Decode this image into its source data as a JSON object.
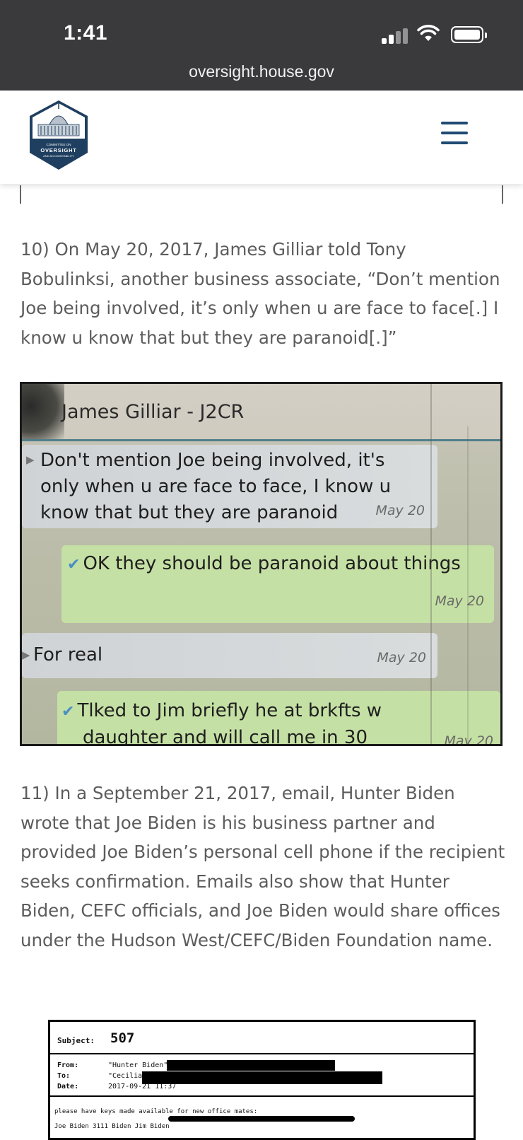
{
  "status_bar": {
    "time": "1:41"
  },
  "browser": {
    "url": "oversight.house.gov"
  },
  "site": {
    "logo": {
      "line1": "COMMITTEE ON",
      "line2": "OVERSIGHT",
      "line3": "AND ACCOUNTABILITY"
    },
    "menu_icon": "hamburger-icon",
    "accent_color": "#1f4a73"
  },
  "article": {
    "para10": "10) On May 20, 2017, James Gilliar told Tony Bobulinksi, another business associate, “Don’t mention Joe being involved, it’s only when u are face to face[.] I know u know that but they are paranoid[.]”",
    "para11": "11) In a September 21, 2017, email, Hunter Biden wrote that Joe Biden is his business partner and provided Joe Biden’s personal cell phone if the recipient seeks confirmation. Emails also show that Hunter Biden, CEFC officials, and Joe Biden would share offices under the Hudson West/CEFC/Biden Foundation name."
  },
  "chat_image": {
    "contact": "James Gilliar - J2CR",
    "messages": [
      {
        "dir": "in",
        "lines": [
          "Don't mention Joe being involved, it's",
          "only when u are face to face, I know u",
          "know that but they are paranoid"
        ],
        "date": "May 20"
      },
      {
        "dir": "out",
        "lines": [
          "OK they should be paranoid about things"
        ],
        "date": "May 20"
      },
      {
        "dir": "in",
        "lines": [
          "For real"
        ],
        "date": "May 20"
      },
      {
        "dir": "out",
        "lines": [
          "Tlked to Jim briefly he at brkfts w",
          "daughter and will call me in 30"
        ],
        "date": "May 20"
      }
    ]
  },
  "email_image": {
    "subject_label": "Subject:",
    "subject_value": "507",
    "from_label": "From:",
    "from_value": "\"Hunter Biden\"",
    "to_label": "To:",
    "to_value": "\"Cecilia",
    "date_label": "Date:",
    "date_value": "2017-09-21 11:37",
    "body_line1": "please have keys made available for new office mates:",
    "body_line2": "Joe Biden 3111 Biden Jim Biden"
  }
}
